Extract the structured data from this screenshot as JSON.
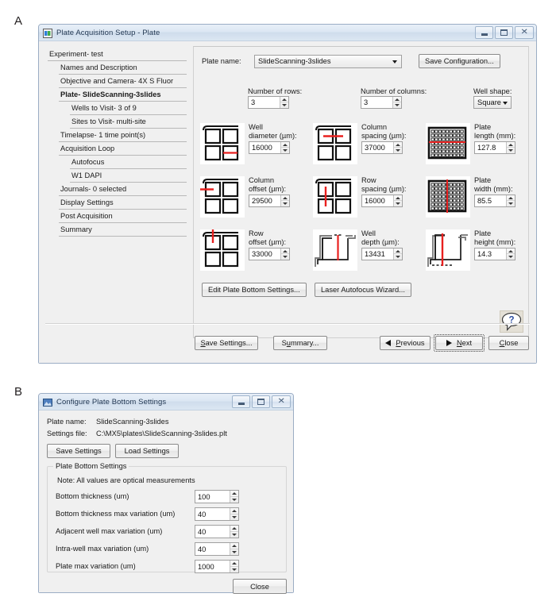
{
  "panels": {
    "a_letter": "A",
    "b_letter": "B"
  },
  "window_a": {
    "title": "Plate Acquisition Setup - Plate",
    "icon": "plate-app-icon",
    "controls": {
      "minimize": "minimize-button",
      "maximize": "maximize-button",
      "close": "close-button",
      "close_glyph": "✕"
    },
    "outline": [
      {
        "label": "Experiment- test",
        "level": 1,
        "selected": false
      },
      {
        "label": "Names and Description",
        "level": 2,
        "selected": false
      },
      {
        "label": "Objective and Camera- 4X S Fluor",
        "level": 2,
        "selected": false
      },
      {
        "label": "Plate- SlideScanning-3slides",
        "level": 2,
        "selected": true
      },
      {
        "label": "Wells to Visit- 3 of 9",
        "level": 3,
        "selected": false
      },
      {
        "label": "Sites to Visit- multi-site",
        "level": 3,
        "selected": false
      },
      {
        "label": "Timelapse- 1 time point(s)",
        "level": 2,
        "selected": false
      },
      {
        "label": "Acquisition Loop",
        "level": 2,
        "selected": false
      },
      {
        "label": "Autofocus",
        "level": 3,
        "selected": false
      },
      {
        "label": "W1 DAPI",
        "level": 3,
        "selected": false
      },
      {
        "label": "Journals- 0 selected",
        "level": 2,
        "selected": false
      },
      {
        "label": "Display Settings",
        "level": 2,
        "selected": false
      },
      {
        "label": "Post Acquisition",
        "level": 2,
        "selected": false
      },
      {
        "label": "Summary",
        "level": 2,
        "selected": false
      }
    ],
    "plate_name_label": "Plate name:",
    "plate_name_value": "SlideScanning-3slides",
    "save_configuration_button": "Save Configuration...",
    "rows_label": "Number of rows:",
    "rows_value": "3",
    "columns_label": "Number of columns:",
    "columns_value": "3",
    "well_shape_label": "Well shape:",
    "well_shape_value": "Square",
    "parameters": [
      {
        "name": "well-diameter",
        "label_line1": "Well",
        "label_line2": "diameter (µm):",
        "value": "16000",
        "icon": "well-grid-diameter-icon"
      },
      {
        "name": "column-spacing",
        "label_line1": "Column",
        "label_line2": "spacing (µm):",
        "value": "37000",
        "icon": "well-grid-column-spacing-icon"
      },
      {
        "name": "plate-length",
        "label_line1": "Plate",
        "label_line2": "length (mm):",
        "value": "127.8",
        "icon": "plate-length-icon"
      },
      {
        "name": "column-offset",
        "label_line1": "Column",
        "label_line2": "offset (µm):",
        "value": "29500",
        "icon": "well-grid-column-offset-icon"
      },
      {
        "name": "row-spacing",
        "label_line1": "Row",
        "label_line2": "spacing (µm):",
        "value": "16000",
        "icon": "well-grid-row-spacing-icon"
      },
      {
        "name": "plate-width",
        "label_line1": "Plate",
        "label_line2": "width (mm):",
        "value": "85.5",
        "icon": "plate-width-icon"
      },
      {
        "name": "row-offset",
        "label_line1": "Row",
        "label_line2": "offset (µm):",
        "value": "33000",
        "icon": "well-grid-row-offset-icon"
      },
      {
        "name": "well-depth",
        "label_line1": "Well",
        "label_line2": "depth (µm):",
        "value": "13431",
        "icon": "well-cross-section-depth-icon"
      },
      {
        "name": "plate-height",
        "label_line1": "Plate",
        "label_line2": "height (mm):",
        "value": "14.3",
        "icon": "plate-cross-section-height-icon"
      }
    ],
    "edit_plate_bottom_button": "Edit Plate Bottom Settings...",
    "laser_autofocus_button": "Laser Autofocus Wizard...",
    "help_icon": "help-balloon-icon",
    "help_glyph": "?",
    "footer": {
      "save_settings": "Save Settings...",
      "save_settings_mnemonic": "S",
      "summary": "Summary...",
      "summary_mnemonic": "u",
      "previous": "Previous",
      "previous_mnemonic": "P",
      "next": "Next",
      "next_mnemonic": "N",
      "close": "Close",
      "close_mnemonic": "C"
    }
  },
  "window_b": {
    "title": "Configure Plate Bottom Settings",
    "icon": "configure-app-icon",
    "controls": {
      "minimize": "minimize-button",
      "maximize": "maximize-button",
      "close": "close-button",
      "close_glyph": "✕"
    },
    "plate_name_label": "Plate name:",
    "plate_name_value": "SlideScanning-3slides",
    "settings_file_label": "Settings file:",
    "settings_file_value": "C:\\MX5\\plates\\SlideScanning-3slides.plt",
    "save_settings_button": "Save Settings",
    "load_settings_button": "Load Settings",
    "group_legend": "Plate Bottom Settings",
    "note": "Note: All values are optical measurements",
    "fields": [
      {
        "label": "Bottom thickness (um)",
        "value": "100"
      },
      {
        "label": "Bottom thickness max variation (um)",
        "value": "40"
      },
      {
        "label": "Adjacent well max variation (um)",
        "value": "40"
      },
      {
        "label": "Intra-well max variation (um)",
        "value": "40"
      },
      {
        "label": "Plate max variation (um)",
        "value": "1000"
      }
    ],
    "close_button": "Close"
  },
  "colors": {
    "accent_red": "#e8201f",
    "titlebar_text": "#1f3550",
    "window_bg": "#f0f0f0",
    "help_blue": "#2b4da0"
  }
}
